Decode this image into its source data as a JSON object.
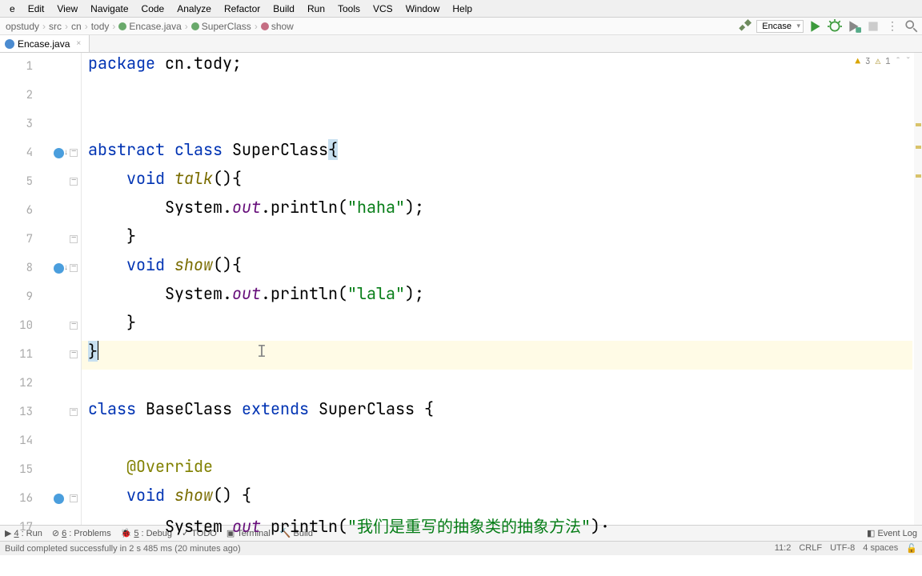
{
  "menu": [
    "e",
    "Edit",
    "View",
    "Navigate",
    "Code",
    "Analyze",
    "Refactor",
    "Build",
    "Run",
    "Tools",
    "VCS",
    "Window",
    "Help"
  ],
  "breadcrumbs": [
    "opstudy",
    "src",
    "cn",
    "tody",
    "Encase.java",
    "SuperClass",
    "show"
  ],
  "run_config": "Encase",
  "tab_name": "Encase.java",
  "inspections": {
    "warnings": "3",
    "weak": "1"
  },
  "code_lines": {
    "1": [
      {
        "t": "package ",
        "c": "kw"
      },
      {
        "t": "cn.tody;",
        "c": ""
      }
    ],
    "2": [],
    "3": [],
    "4": [
      {
        "t": "abstract class ",
        "c": "kw"
      },
      {
        "t": "SuperClass",
        "c": "cls"
      },
      {
        "t": "{",
        "c": "brace-hl"
      }
    ],
    "5": [
      {
        "t": "    ",
        "c": ""
      },
      {
        "t": "void ",
        "c": "kw"
      },
      {
        "t": "talk",
        "c": "mth"
      },
      {
        "t": "(){",
        "c": ""
      }
    ],
    "6": [
      {
        "t": "        System.",
        "c": ""
      },
      {
        "t": "out",
        "c": "fld"
      },
      {
        "t": ".println(",
        "c": ""
      },
      {
        "t": "\"haha\"",
        "c": "str"
      },
      {
        "t": ");",
        "c": ""
      }
    ],
    "7": [
      {
        "t": "    }",
        "c": ""
      }
    ],
    "8": [
      {
        "t": "    ",
        "c": ""
      },
      {
        "t": "void ",
        "c": "kw"
      },
      {
        "t": "show",
        "c": "mth"
      },
      {
        "t": "(){",
        "c": ""
      }
    ],
    "9": [
      {
        "t": "        System.",
        "c": ""
      },
      {
        "t": "out",
        "c": "fld"
      },
      {
        "t": ".println(",
        "c": ""
      },
      {
        "t": "\"lala\"",
        "c": "str"
      },
      {
        "t": ");",
        "c": ""
      }
    ],
    "10": [
      {
        "t": "    }",
        "c": ""
      }
    ],
    "11": [
      {
        "t": "}",
        "c": "brace-hl"
      }
    ],
    "12": [],
    "13": [
      {
        "t": "class ",
        "c": "kw"
      },
      {
        "t": "BaseClass ",
        "c": "cls"
      },
      {
        "t": "extends ",
        "c": "kw"
      },
      {
        "t": "SuperClass {",
        "c": "cls"
      }
    ],
    "14": [],
    "15": [
      {
        "t": "    ",
        "c": ""
      },
      {
        "t": "@Override",
        "c": "ann"
      }
    ],
    "16": [
      {
        "t": "    ",
        "c": ""
      },
      {
        "t": "void ",
        "c": "kw"
      },
      {
        "t": "show",
        "c": "mth"
      },
      {
        "t": "() {",
        "c": ""
      }
    ],
    "17": [
      {
        "t": "        System ",
        "c": ""
      },
      {
        "t": "out",
        "c": "fld"
      },
      {
        "t": " println(",
        "c": ""
      },
      {
        "t": "\"我们是重写的抽象类的抽象方法\"",
        "c": "comment"
      },
      {
        "t": ")·",
        "c": ""
      }
    ]
  },
  "bottom_tabs": {
    "run": "Run",
    "problems": "Problems",
    "debug": "Debug",
    "todo": "TODO",
    "terminal": "Terminal",
    "build": "Build",
    "eventlog": "Event Log"
  },
  "status": {
    "msg": "Build completed successfully in 2 s 485 ms (20 minutes ago)",
    "pos": "11:2",
    "lf": "CRLF",
    "enc": "UTF-8",
    "indent": "4 spaces"
  }
}
